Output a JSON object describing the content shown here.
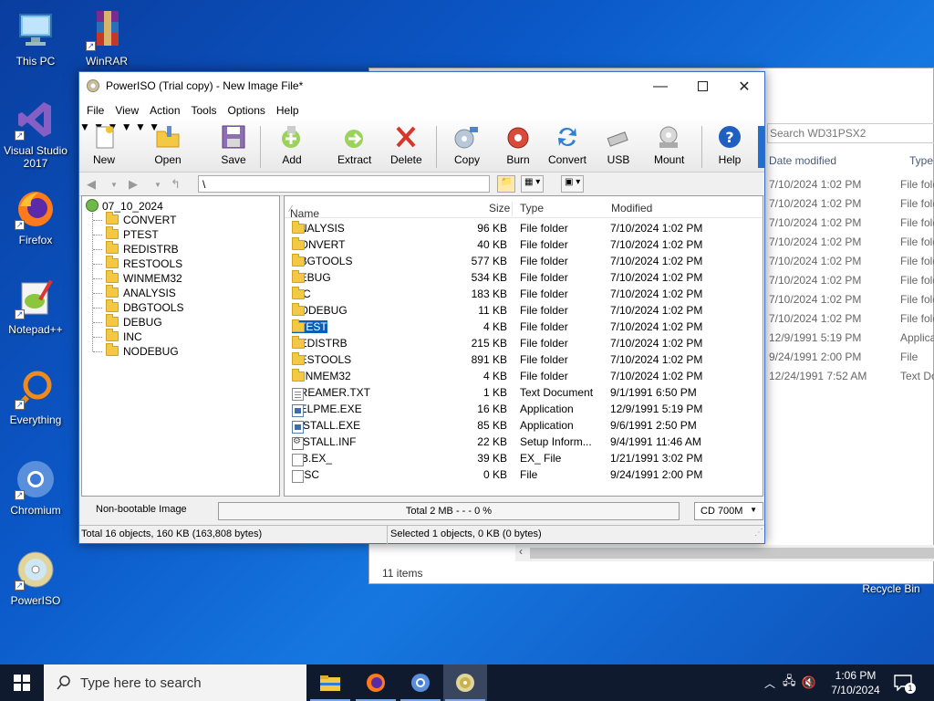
{
  "desktop": {
    "icons": [
      {
        "label": "This PC"
      },
      {
        "label": "WinRAR"
      },
      {
        "label": "Visual Studio 2017"
      },
      {
        "label": "Firefox"
      },
      {
        "label": "Notepad++"
      },
      {
        "label": "Everything"
      },
      {
        "label": "Chromium"
      },
      {
        "label": "PowerISO"
      }
    ],
    "recycle_bin": "Recycle Bin"
  },
  "bg_explorer": {
    "search_placeholder": "Search WD31PSX2",
    "col_date": "Date modified",
    "col_type": "Type",
    "rows": [
      {
        "date": "7/10/2024 1:02 PM",
        "type": "File fold"
      },
      {
        "date": "7/10/2024 1:02 PM",
        "type": "File fold"
      },
      {
        "date": "7/10/2024 1:02 PM",
        "type": "File fold"
      },
      {
        "date": "7/10/2024 1:02 PM",
        "type": "File fold"
      },
      {
        "date": "7/10/2024 1:02 PM",
        "type": "File fold"
      },
      {
        "date": "7/10/2024 1:02 PM",
        "type": "File fold"
      },
      {
        "date": "7/10/2024 1:02 PM",
        "type": "File fold"
      },
      {
        "date": "7/10/2024 1:02 PM",
        "type": "File fold"
      },
      {
        "date": "12/9/1991 5:19 PM",
        "type": "Applica"
      },
      {
        "date": "9/24/1991 2:00 PM",
        "type": "File"
      },
      {
        "date": "12/24/1991 7:52 AM",
        "type": "Text Do"
      }
    ],
    "items_count": "11 items"
  },
  "window": {
    "title": "PowerISO (Trial copy) - New Image File*",
    "menu": [
      "File",
      "View",
      "Action",
      "Tools",
      "Options",
      "Help"
    ],
    "toolbar": {
      "new": "New",
      "open": "Open",
      "save": "Save",
      "add": "Add",
      "extract": "Extract",
      "delete": "Delete",
      "copy": "Copy",
      "burn": "Burn",
      "convert": "Convert",
      "usb": "USB",
      "mount": "Mount",
      "help": "Help"
    },
    "path": "\\",
    "tree": {
      "root": "07_10_2024",
      "children": [
        "CONVERT",
        "PTEST",
        "REDISTRB",
        "RESTOOLS",
        "WINMEM32",
        "ANALYSIS",
        "DBGTOOLS",
        "DEBUG",
        "INC",
        "NODEBUG"
      ]
    },
    "columns": {
      "name": "Name",
      "size": "Size",
      "type": "Type",
      "modified": "Modified"
    },
    "files": [
      {
        "name": "ANALYSIS",
        "size": "96 KB",
        "type": "File folder",
        "modified": "7/10/2024 1:02 PM",
        "icon": "folder"
      },
      {
        "name": "CONVERT",
        "size": "40 KB",
        "type": "File folder",
        "modified": "7/10/2024 1:02 PM",
        "icon": "folder"
      },
      {
        "name": "DBGTOOLS",
        "size": "577 KB",
        "type": "File folder",
        "modified": "7/10/2024 1:02 PM",
        "icon": "folder"
      },
      {
        "name": "DEBUG",
        "size": "534 KB",
        "type": "File folder",
        "modified": "7/10/2024 1:02 PM",
        "icon": "folder"
      },
      {
        "name": "INC",
        "size": "183 KB",
        "type": "File folder",
        "modified": "7/10/2024 1:02 PM",
        "icon": "folder"
      },
      {
        "name": "NODEBUG",
        "size": "11 KB",
        "type": "File folder",
        "modified": "7/10/2024 1:02 PM",
        "icon": "folder"
      },
      {
        "name": "PTEST",
        "size": "4 KB",
        "type": "File folder",
        "modified": "7/10/2024 1:02 PM",
        "icon": "folder",
        "selected": true
      },
      {
        "name": "REDISTRB",
        "size": "215 KB",
        "type": "File folder",
        "modified": "7/10/2024 1:02 PM",
        "icon": "folder"
      },
      {
        "name": "RESTOOLS",
        "size": "891 KB",
        "type": "File folder",
        "modified": "7/10/2024 1:02 PM",
        "icon": "folder"
      },
      {
        "name": "WINMEM32",
        "size": "4 KB",
        "type": "File folder",
        "modified": "7/10/2024 1:02 PM",
        "icon": "folder"
      },
      {
        "name": "DREAMER.TXT",
        "size": "1 KB",
        "type": "Text Document",
        "modified": "9/1/1991 6:50 PM",
        "icon": "txt"
      },
      {
        "name": "HELPME.EXE",
        "size": "16 KB",
        "type": "Application",
        "modified": "12/9/1991 5:19 PM",
        "icon": "app"
      },
      {
        "name": "INSTALL.EXE",
        "size": "85 KB",
        "type": "Application",
        "modified": "9/6/1991 2:50 PM",
        "icon": "app"
      },
      {
        "name": "INSTALL.INF",
        "size": "22 KB",
        "type": "Setup Inform...",
        "modified": "9/4/1991 11:46 AM",
        "icon": "inf"
      },
      {
        "name": "LIB.EX_",
        "size": "39 KB",
        "type": "EX_ File",
        "modified": "1/21/1991 3:02 PM",
        "icon": "file"
      },
      {
        "name": "MISC",
        "size": "0 KB",
        "type": "File",
        "modified": "9/24/1991 2:00 PM",
        "icon": "file"
      }
    ],
    "status": {
      "boot": "Non-bootable Image",
      "progress": "Total  2 MB   - - -  0 %",
      "media": "CD 700M",
      "total_objects": "Total 16 objects, 160 KB (163,808 bytes)",
      "selected": "Selected 1 objects, 0 KB (0 bytes)"
    }
  },
  "taskbar": {
    "search_placeholder": "Type here to search",
    "time": "1:06 PM",
    "date": "7/10/2024",
    "notification_count": "1"
  },
  "colors": {
    "accent": "#0a5fb5",
    "folder": "#f3c845",
    "taskbar": "#101a2e"
  }
}
